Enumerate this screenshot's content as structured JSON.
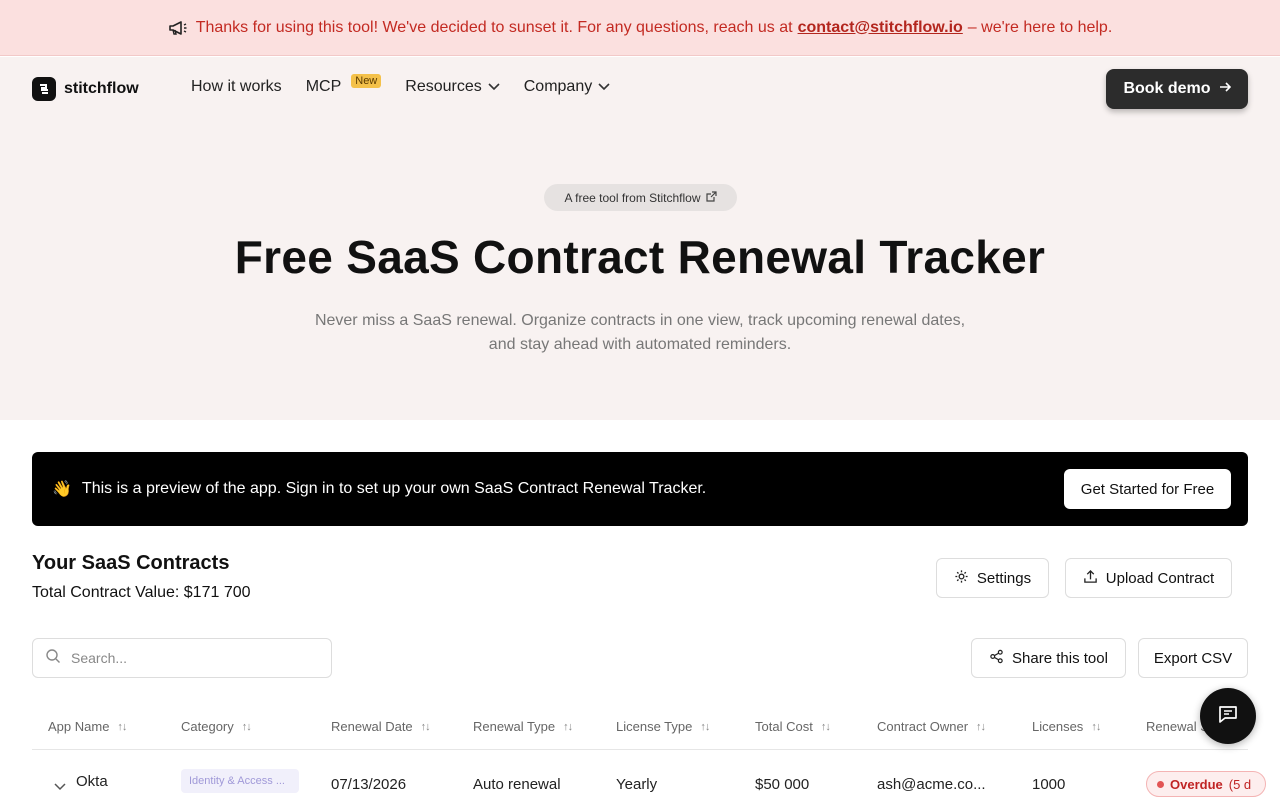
{
  "banner": {
    "text_before": "Thanks for using this tool! We've decided to sunset it. For any questions, reach us at",
    "email": "contact@stitchflow.io",
    "text_after": "– we're here to help.",
    "icon": "megaphone-icon"
  },
  "nav": {
    "brand": "stitchflow",
    "links": [
      "How it works",
      "MCP",
      "Resources",
      "Company"
    ],
    "new_badge": "New",
    "book_demo": "Book demo"
  },
  "hero": {
    "pill": "A free tool from Stitchflow",
    "title": "Free SaaS Contract Renewal Tracker",
    "subtitle_line1": "Never miss a SaaS renewal. Organize contracts in one view, track upcoming renewal dates,",
    "subtitle_line2": "and stay ahead with automated reminders."
  },
  "preview": {
    "emoji": "👋",
    "text": "This is a preview of the app. Sign in to set up your own SaaS Contract Renewal Tracker.",
    "cta": "Get Started for Free"
  },
  "contracts": {
    "title": "Your SaaS Contracts",
    "total": "Total Contract Value: $171 700",
    "settings": "Settings",
    "upload": "Upload Contract",
    "search_placeholder": "Search...",
    "share": "Share this tool",
    "export": "Export CSV",
    "columns": [
      "App Name",
      "Category",
      "Renewal Date",
      "Renewal Type",
      "License Type",
      "Total Cost",
      "Contract Owner",
      "Licenses",
      "Renewal S"
    ],
    "rows": [
      {
        "app": "Okta",
        "category": "Identity & Access ...",
        "renewal_date": "07/13/2026",
        "renewal_type": "Auto renewal",
        "license_type": "Yearly",
        "total_cost": "$50 000",
        "owner": "ash@acme.co...",
        "licenses": "1000",
        "status": "Overdue",
        "status_detail": "(5 d"
      }
    ]
  },
  "colors": {
    "banner_bg": "#fbe0df",
    "banner_text": "#c32a22",
    "hero_bg": "#f8f2f1",
    "dark": "#111111",
    "badge": "#f4c14a",
    "overdue": "#c02424"
  }
}
